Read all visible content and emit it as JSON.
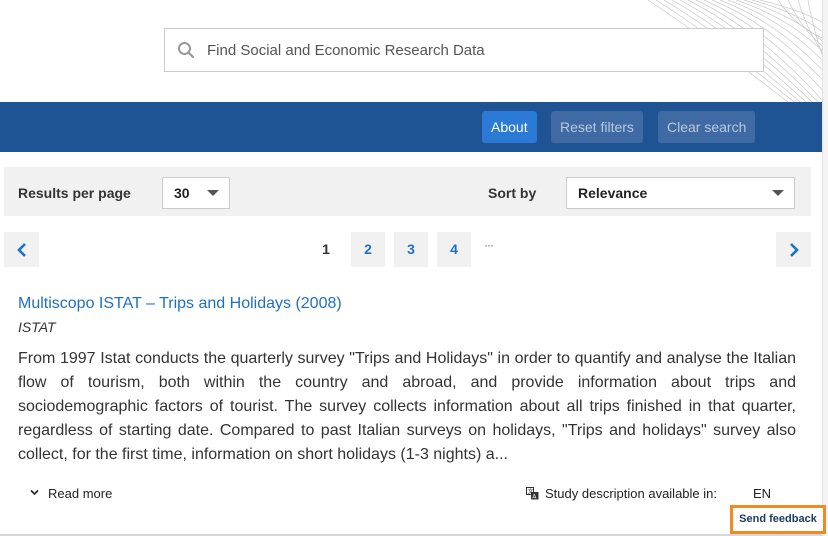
{
  "search": {
    "placeholder": "Find Social and Economic Research Data",
    "value": ""
  },
  "toolbar": {
    "about_label": "About",
    "reset_label": "Reset filters",
    "clear_label": "Clear search"
  },
  "filters": {
    "results_per_page_label": "Results per page",
    "results_per_page_value": "30",
    "sort_by_label": "Sort by",
    "sort_by_value": "Relevance"
  },
  "pagination": {
    "current": "1",
    "pages": [
      "2",
      "3",
      "4"
    ],
    "ellipsis": "···"
  },
  "result": {
    "title": "Multiscopo ISTAT – Trips and Holidays (2008)",
    "publisher": "ISTAT",
    "description": "From 1997 Istat conducts the quarterly survey \"Trips and Holidays\" in order to quantify and analyse the Italian flow of tourism, both within the country and abroad, and provide information about trips and sociodemographic factors of tourist. The survey collects information about all trips finished in that quarter, regardless of starting date. Compared to past Italian surveys on holidays, \"Trips and holidays\" survey also collect, for the first time, information on short holidays (1-3 nights) a...",
    "read_more_label": "Read more",
    "availability_label": "Study description available in:",
    "language": "EN"
  },
  "feedback": {
    "label": "Send feedback"
  },
  "colors": {
    "toolbar_bg": "#1f5394",
    "primary_button": "#2a7ad6",
    "link": "#1f6fc4",
    "feedback_border": "#f28a22"
  }
}
